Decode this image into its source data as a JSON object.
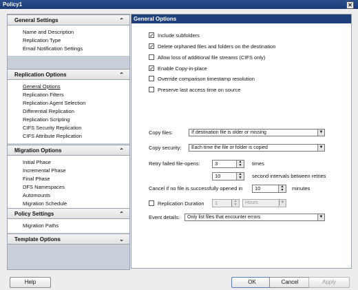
{
  "window": {
    "title": "Policy1",
    "close_glyph": "✕"
  },
  "sidebar": {
    "sections": [
      {
        "label": "General Settings",
        "chevron": "⌃",
        "items": [
          "Name and Description",
          "Replication Type",
          "Email Notification Settings"
        ]
      },
      {
        "label": "Replication Options",
        "chevron": "⌃",
        "items": [
          "General Options",
          "Replication Filters",
          "Replication Agent Selection",
          "Differential Replication",
          "Replication Scripting",
          "CIFS Security Replication",
          "CIFS Attribute Replication"
        ]
      },
      {
        "label": "Migration Options",
        "chevron": "⌃",
        "items": [
          "Initial Phase",
          "Incremental Phase",
          "Final Phase",
          "DFS Namespaces",
          "Automounts",
          "Migration Schedule"
        ]
      },
      {
        "label": "Policy Settings",
        "chevron": "⌃",
        "items": [
          "Migration Paths"
        ]
      },
      {
        "label": "Template Options",
        "chevron": "⌄"
      }
    ]
  },
  "main": {
    "header": "General Options",
    "checkboxes": [
      {
        "label": "Include subfolders",
        "checked": true
      },
      {
        "label": "Delete orphaned files and folders on the destination",
        "checked": true
      },
      {
        "label": "Allow loss of additional file streams (CIFS only)",
        "checked": false
      },
      {
        "label": "Enable Copy-in-place",
        "checked": true
      },
      {
        "label": "Override comparison timestamp resolution",
        "checked": false
      },
      {
        "label": "Preserve last access time on source",
        "checked": false
      }
    ],
    "copy_files": {
      "label": "Copy files:",
      "value": "If destination file is older or missing"
    },
    "copy_security": {
      "label": "Copy security:",
      "value": "Each time the file or folder is copied"
    },
    "retry": {
      "label": "Retry failed file-opens:",
      "times_value": "3",
      "times_unit": "times",
      "interval_value": "10",
      "interval_unit": "second intervals between retries"
    },
    "cancel": {
      "label": "Cancel if no file is successfully opened in",
      "value": "10",
      "unit": "minutes"
    },
    "replication_duration": {
      "label": "Replication Duration",
      "checked": false,
      "value": "1",
      "unit": "Hours"
    },
    "event_details": {
      "label": "Event details:",
      "value": "Only list files that encounter errors"
    }
  },
  "buttons": {
    "help": "Help",
    "ok": "OK",
    "cancel": "Cancel",
    "apply": "Apply"
  },
  "glyphs": {
    "check": "✓",
    "dropdown": "▼",
    "spin_up": "▲",
    "spin_down": "▼"
  }
}
